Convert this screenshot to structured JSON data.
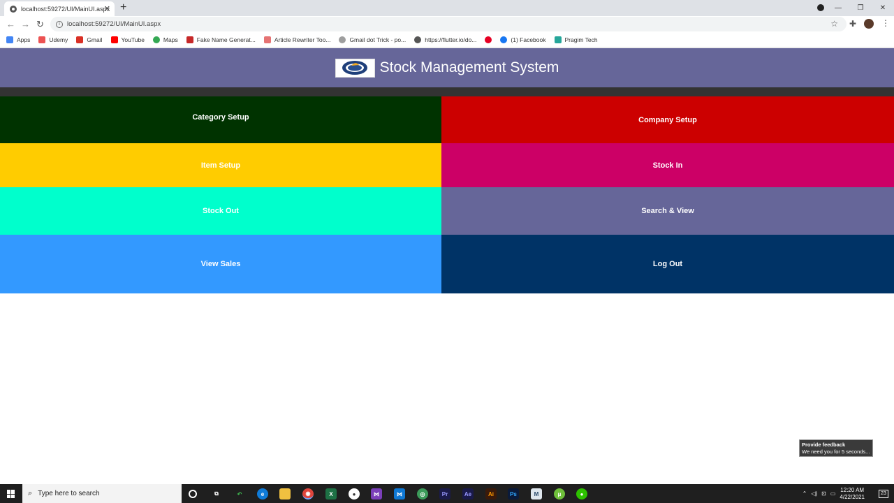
{
  "browser": {
    "tab_title": "localhost:59272/UI/MainUI.aspx",
    "url": "localhost:59272/UI/MainUI.aspx",
    "bookmarks": [
      {
        "label": "Apps",
        "icon": "apps-grid-icon",
        "color": "#4285f4"
      },
      {
        "label": "Udemy",
        "icon": "udemy-icon",
        "color": "#ec5252"
      },
      {
        "label": "Gmail",
        "icon": "gmail-icon",
        "color": "#d93025"
      },
      {
        "label": "YouTube",
        "icon": "youtube-icon",
        "color": "#ff0000"
      },
      {
        "label": "Maps",
        "icon": "maps-icon",
        "color": "#34a853"
      },
      {
        "label": "Fake Name Generat...",
        "icon": "fake-name-icon",
        "color": "#c62828"
      },
      {
        "label": "Article Rewriter Too...",
        "icon": "article-rewriter-icon",
        "color": "#e57373"
      },
      {
        "label": "Gmail dot Trick - po...",
        "icon": "gmail-dot-icon",
        "color": "#9e9e9e"
      },
      {
        "label": "https://flutter.io/do...",
        "icon": "globe-icon",
        "color": "#555555"
      },
      {
        "label": "",
        "icon": "pinterest-icon",
        "color": "#e60023"
      },
      {
        "label": "(1) Facebook",
        "icon": "facebook-icon",
        "color": "#1877f2"
      },
      {
        "label": "Pragim Tech",
        "icon": "pragim-icon",
        "color": "#26a69a"
      }
    ]
  },
  "header": {
    "title": "Stock Management System"
  },
  "menu": [
    {
      "label": "Category Setup",
      "color": "#003300"
    },
    {
      "label": "Company Setup",
      "color": "#cc0000"
    },
    {
      "label": "Item Setup",
      "color": "#ffcc00"
    },
    {
      "label": "Stock In",
      "color": "#cc0066"
    },
    {
      "label": "Stock Out",
      "color": "#00ffcc"
    },
    {
      "label": "Search & View",
      "color": "#666699"
    },
    {
      "label": "View Sales",
      "color": "#3399ff"
    },
    {
      "label": "Log Out",
      "color": "#003366"
    }
  ],
  "feedback": {
    "title": "Provide feedback",
    "text": "We need you for 5 seconds..."
  },
  "taskbar": {
    "search_placeholder": "Type here to search",
    "time": "12:20 AM",
    "date": "4/22/2021",
    "notification_count": "23"
  }
}
